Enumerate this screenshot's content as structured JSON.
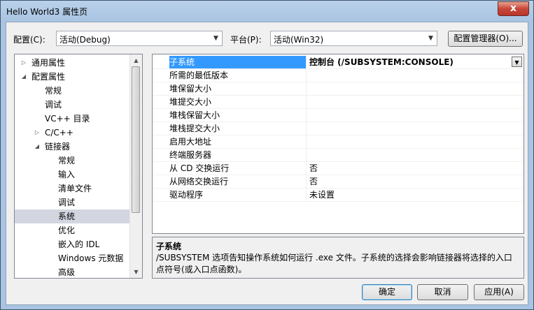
{
  "window": {
    "title": "Hello World3 属性页",
    "close_glyph": "x"
  },
  "config": {
    "label": "配置(C):",
    "value": "活动(Debug)"
  },
  "platform": {
    "label": "平台(P):",
    "value": "活动(Win32)"
  },
  "config_manager_label": "配置管理器(O)...",
  "tree": [
    {
      "label": "通用属性",
      "arrow": "▷"
    },
    {
      "label": "配置属性",
      "arrow": "◢"
    },
    {
      "label": "常规"
    },
    {
      "label": "调试"
    },
    {
      "label": "VC++ 目录"
    },
    {
      "label": "C/C++",
      "arrow": "▷"
    },
    {
      "label": "链接器",
      "arrow": "◢"
    },
    {
      "label": "常规"
    },
    {
      "label": "输入"
    },
    {
      "label": "清单文件"
    },
    {
      "label": "调试"
    },
    {
      "label": "系统"
    },
    {
      "label": "优化"
    },
    {
      "label": "嵌入的 IDL"
    },
    {
      "label": "Windows 元数据"
    },
    {
      "label": "高级"
    }
  ],
  "properties": [
    {
      "name": "子系统",
      "value": "控制台 (/SUBSYSTEM:CONSOLE)"
    },
    {
      "name": "所需的最低版本",
      "value": ""
    },
    {
      "name": "堆保留大小",
      "value": ""
    },
    {
      "name": "堆提交大小",
      "value": ""
    },
    {
      "name": "堆栈保留大小",
      "value": ""
    },
    {
      "name": "堆栈提交大小",
      "value": ""
    },
    {
      "name": "启用大地址",
      "value": ""
    },
    {
      "name": "终端服务器",
      "value": ""
    },
    {
      "name": "从 CD 交换运行",
      "value": "否"
    },
    {
      "name": "从网络交换运行",
      "value": "否"
    },
    {
      "name": "驱动程序",
      "value": "未设置"
    }
  ],
  "description": {
    "title": "子系统",
    "text": "/SUBSYSTEM 选项告知操作系统如何运行 .exe 文件。子系统的选择会影响链接器将选择的入口点符号(或入口点函数)。"
  },
  "buttons": {
    "ok": "确定",
    "cancel": "取消",
    "apply": "应用(A)"
  }
}
